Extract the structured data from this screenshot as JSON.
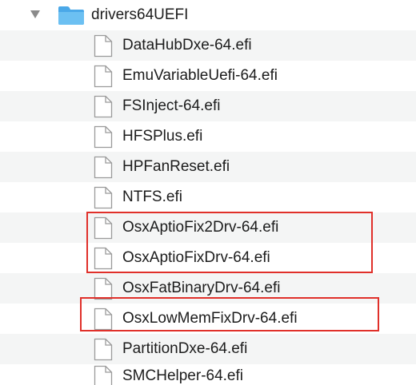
{
  "folder": {
    "name": "drivers64UEFI",
    "expanded": true,
    "icon": "folder-icon"
  },
  "files": [
    {
      "name": "DataHubDxe-64.efi"
    },
    {
      "name": "EmuVariableUefi-64.efi"
    },
    {
      "name": "FSInject-64.efi"
    },
    {
      "name": "HFSPlus.efi"
    },
    {
      "name": "HPFanReset.efi"
    },
    {
      "name": "NTFS.efi"
    },
    {
      "name": "OsxAptioFix2Drv-64.efi"
    },
    {
      "name": "OsxAptioFixDrv-64.efi"
    },
    {
      "name": "OsxFatBinaryDrv-64.efi"
    },
    {
      "name": "OsxLowMemFixDrv-64.efi"
    },
    {
      "name": "PartitionDxe-64.efi"
    },
    {
      "name": "SMCHelper-64.efi"
    }
  ],
  "highlights": [
    {
      "files": [
        "OsxAptioFix2Drv-64.efi",
        "OsxAptioFixDrv-64.efi"
      ]
    },
    {
      "files": [
        "OsxLowMemFixDrv-64.efi"
      ]
    }
  ],
  "colors": {
    "highlight": "#e0302a",
    "folder": "#4aa8e8",
    "stripe": "#f4f5f5"
  }
}
